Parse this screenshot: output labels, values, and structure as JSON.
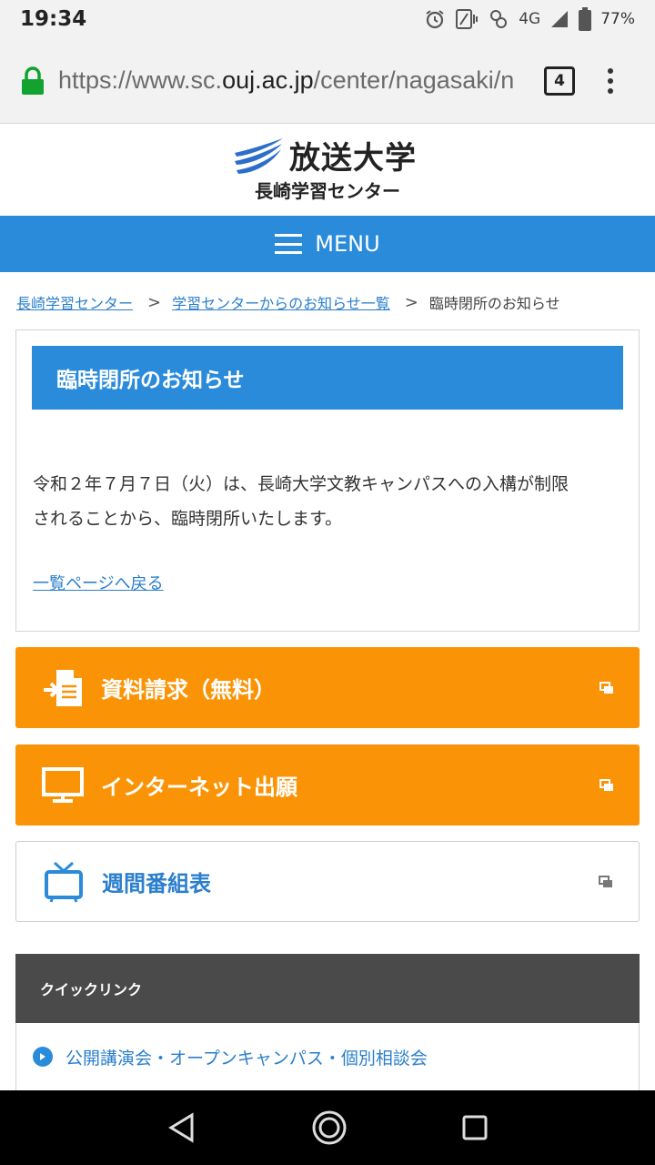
{
  "status": {
    "time": "19:34",
    "network": "4G",
    "battery": "77%"
  },
  "browser": {
    "url_scheme": "https://www.sc.",
    "url_host": "ouj.ac.jp",
    "url_path": "/center/nagasaki/n",
    "tab_count": "4"
  },
  "site": {
    "logo_title": "放送大学",
    "logo_subtitle": "長崎学習センター",
    "menu_label": "MENU",
    "brand_color": "#2b8bdb"
  },
  "breadcrumb": {
    "items": [
      "長崎学習センター",
      "学習センターからのお知らせ一覧",
      "臨時閉所のお知らせ"
    ],
    "separator": ">"
  },
  "article": {
    "title": "臨時閉所のお知らせ",
    "body_line1": "令和２年７月７日（火）は、長崎大学文教キャンパスへの入構が制限",
    "body_line2": "されることから、臨時閉所いたします。",
    "back_link": "一覧ページへ戻る"
  },
  "actions": [
    {
      "label": "資料請求（無料）",
      "icon": "document-request-icon",
      "color": "#fb9306"
    },
    {
      "label": "インターネット出願",
      "icon": "monitor-icon",
      "color": "#fb9306"
    },
    {
      "label": "週間番組表",
      "icon": "tv-icon",
      "color": "#ffffff"
    }
  ],
  "quick_links": {
    "heading": "クイックリンク",
    "items": [
      "公開講演会・オープンキャンパス・個別相談会"
    ]
  }
}
